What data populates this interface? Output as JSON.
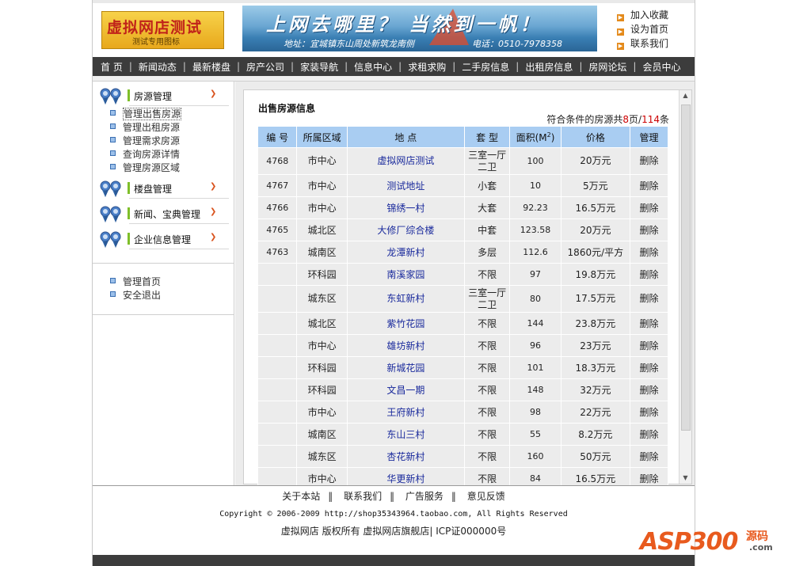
{
  "header": {
    "logo_title": "虚拟网店测试",
    "logo_sub": "测试专用图标",
    "banner_slogan": "上网去哪里？  当然到一帆！",
    "banner_address": "地址：宜城镇东山周处新筑龙南侧",
    "banner_phone": "电话：0510-7978358",
    "quick_links": [
      "加入收藏",
      "设为首页",
      "联系我们"
    ]
  },
  "nav": [
    "首 页",
    "新闻动态",
    "最新楼盘",
    "房产公司",
    "家装导航",
    "信息中心",
    "求租求购",
    "二手房信息",
    "出租房信息",
    "房网论坛",
    "会员中心"
  ],
  "sidebar": {
    "sections": [
      {
        "title": "房源管理",
        "items": [
          "管理出售房源",
          "管理出租房源",
          "管理需求房源",
          "查询房源详情",
          "管理房源区域"
        ]
      },
      {
        "title": "楼盘管理",
        "items": []
      },
      {
        "title": "新闻、宝典管理",
        "items": []
      },
      {
        "title": "企业信息管理",
        "items": []
      }
    ],
    "bottom_items": [
      "管理首页",
      "安全退出"
    ]
  },
  "main": {
    "title": "出售房源信息",
    "count_prefix": "符合条件的房源共",
    "pages": "8",
    "count_mid": "页/",
    "total": "114",
    "count_suffix": "条",
    "columns": [
      "编 号",
      "所属区域",
      "地 点",
      "套 型",
      "面积(M²)",
      "价格",
      "管理"
    ],
    "rows": [
      {
        "id": "4768",
        "area": "市中心",
        "location": "虚拟网店测试",
        "type": "三室一厅二卫",
        "size": "100",
        "price": "20万元",
        "action": "删除"
      },
      {
        "id": "4767",
        "area": "市中心",
        "location": "测试地址",
        "type": "小套",
        "size": "10",
        "price": "5万元",
        "action": "删除"
      },
      {
        "id": "4766",
        "area": "市中心",
        "location": "锦绣一村",
        "type": "大套",
        "size": "92.23",
        "price": "16.5万元",
        "action": "删除"
      },
      {
        "id": "4765",
        "area": "城北区",
        "location": "大修厂综合楼",
        "type": "中套",
        "size": "123.58",
        "price": "20万元",
        "action": "删除"
      },
      {
        "id": "4763",
        "area": "城南区",
        "location": "龙潭新村",
        "type": "多层",
        "size": "112.6",
        "price": "1860元/平方",
        "action": "删除"
      },
      {
        "id": "",
        "area": "环科园",
        "location": "南溪家园",
        "type": "不限",
        "size": "97",
        "price": "19.8万元",
        "action": "删除"
      },
      {
        "id": "",
        "area": "城东区",
        "location": "东虹新村",
        "type": "三室一厅二卫",
        "size": "80",
        "price": "17.5万元",
        "action": "删除"
      },
      {
        "id": "",
        "area": "城北区",
        "location": "紫竹花园",
        "type": "不限",
        "size": "144",
        "price": "23.8万元",
        "action": "删除"
      },
      {
        "id": "",
        "area": "市中心",
        "location": "雄坊新村",
        "type": "不限",
        "size": "96",
        "price": "23万元",
        "action": "删除"
      },
      {
        "id": "",
        "area": "环科园",
        "location": "新城花园",
        "type": "不限",
        "size": "101",
        "price": "18.3万元",
        "action": "删除"
      },
      {
        "id": "",
        "area": "环科园",
        "location": "文昌一期",
        "type": "不限",
        "size": "148",
        "price": "32万元",
        "action": "删除"
      },
      {
        "id": "",
        "area": "市中心",
        "location": "王府新村",
        "type": "不限",
        "size": "98",
        "price": "22万元",
        "action": "删除"
      },
      {
        "id": "",
        "area": "城南区",
        "location": "东山三村",
        "type": "不限",
        "size": "55",
        "price": "8.2万元",
        "action": "删除"
      },
      {
        "id": "",
        "area": "城东区",
        "location": "杏花新村",
        "type": "不限",
        "size": "160",
        "price": "50万元",
        "action": "删除"
      },
      {
        "id": "",
        "area": "市中心",
        "location": "华更新村",
        "type": "不限",
        "size": "84",
        "price": "16.5万元",
        "action": "删除"
      }
    ]
  },
  "footer": {
    "links": [
      "关于本站",
      "联系我们",
      "广告服务",
      "意见反馈"
    ],
    "separator": "‖",
    "copyright": "Copyright © 2006-2009 http://shop35343964.taobao.com, All Rights Reserved",
    "owner": "虚拟网店 版权所有 虚拟网店旗舰店| ICP证000000号"
  },
  "watermark": {
    "main": "ASP300",
    "cn": "源码",
    "domain": ".com"
  },
  "colors": {
    "nav_bg": "#3c3c3c",
    "table_header": "#a9cdf2",
    "table_cell": "#ececec",
    "link": "#1a2a9c",
    "accent_green": "#7fbf2a",
    "count_red": "#cc0000"
  }
}
